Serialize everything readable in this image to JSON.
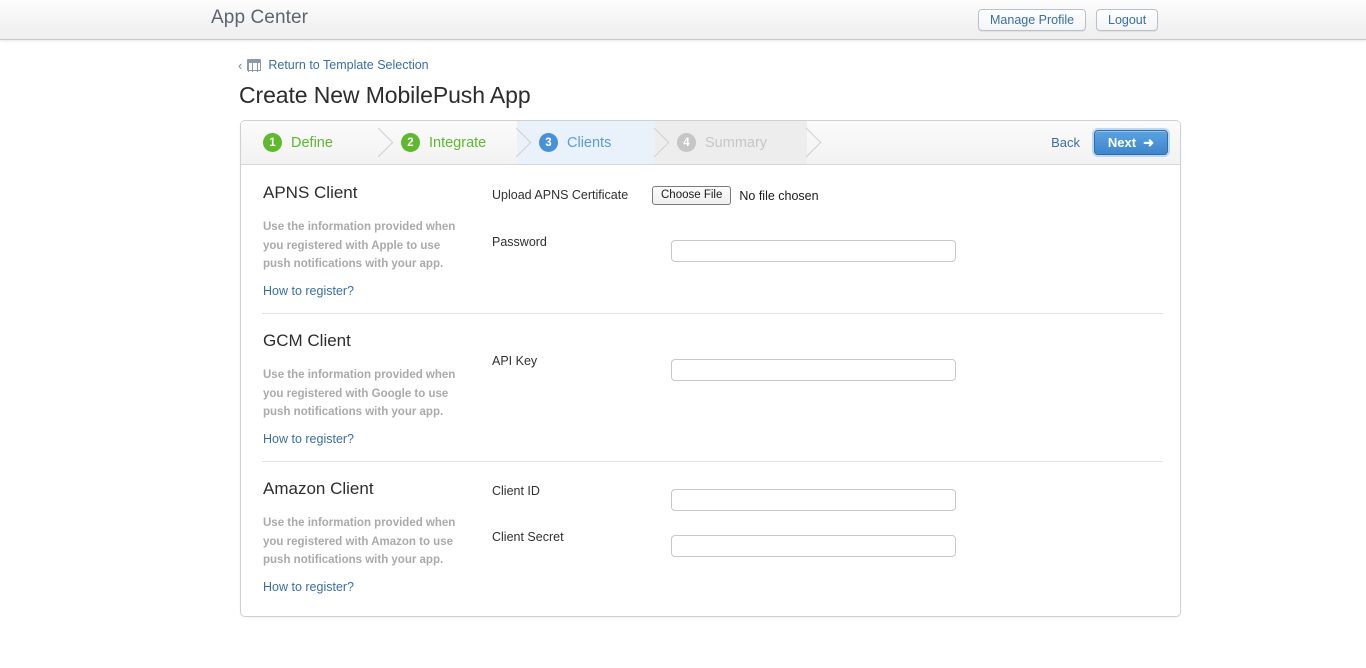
{
  "header": {
    "app_title": "App Center",
    "manage_profile_label": "Manage Profile",
    "logout_label": "Logout"
  },
  "breadcrumb": {
    "chevron": "‹",
    "icon": "grid-icon",
    "link_label": "Return to Template Selection"
  },
  "page_title": "Create New MobilePush App",
  "wizard": {
    "steps": [
      {
        "number": "1",
        "label": "Define",
        "state": "done"
      },
      {
        "number": "2",
        "label": "Integrate",
        "state": "done"
      },
      {
        "number": "3",
        "label": "Clients",
        "state": "active"
      },
      {
        "number": "4",
        "label": "Summary",
        "state": "pending"
      }
    ],
    "back_label": "Back",
    "next_label": "Next",
    "next_arrow": "➜",
    "colors": {
      "done": "#5fb82d",
      "active": "#4a90d9",
      "pending": "#c6c6c6",
      "active_bg": "#e9f1fb",
      "pending_bg": "#ededed",
      "next_button": "#3d86cc"
    }
  },
  "sections": [
    {
      "title": "APNS Client",
      "description": "Use the information provided when you registered with Apple to use push notifications with your app.",
      "how_to_label": "How to register?",
      "upload": {
        "label": "Upload APNS Certificate",
        "button_label": "Choose File",
        "status": "No file chosen"
      },
      "fields": [
        {
          "label": "Password",
          "value": "",
          "placeholder": "",
          "type": "password"
        }
      ]
    },
    {
      "title": "GCM Client",
      "description": "Use the information provided when you registered with Google to use push notifications with your app.",
      "how_to_label": "How to register?",
      "fields": [
        {
          "label": "API Key",
          "value": "",
          "placeholder": "",
          "type": "text"
        }
      ]
    },
    {
      "title": "Amazon Client",
      "description": "Use the information provided when you registered with Amazon to use push notifications with your app.",
      "how_to_label": "How to register?",
      "fields": [
        {
          "label": "Client ID",
          "value": "",
          "placeholder": "",
          "type": "text"
        },
        {
          "label": "Client Secret",
          "value": "",
          "placeholder": "",
          "type": "text"
        }
      ]
    }
  ]
}
